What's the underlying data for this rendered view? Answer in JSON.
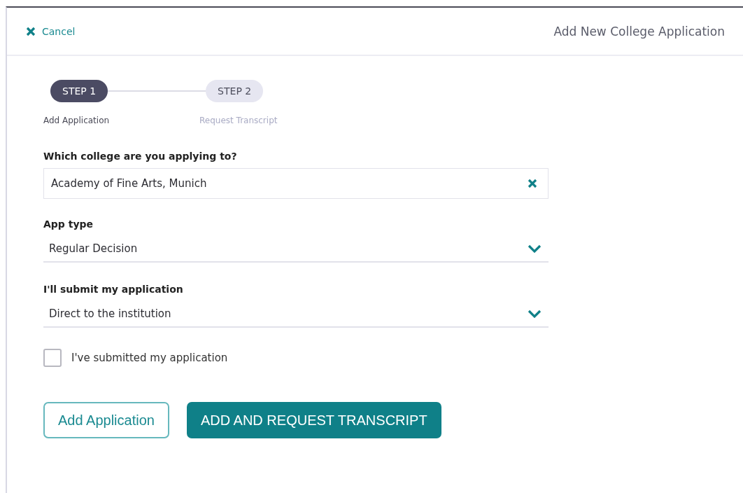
{
  "header": {
    "cancel": "Cancel",
    "title": "Add New College Application"
  },
  "steps": [
    {
      "label": "STEP 1",
      "caption": "Add Application",
      "selected": true
    },
    {
      "label": "STEP 2",
      "caption": "Request Transcript",
      "selected": false
    }
  ],
  "fields": [
    {
      "kind": "text",
      "label": "Which college are you applying to?",
      "value": "Academy of Fine Arts, Munich"
    },
    {
      "kind": "select",
      "label": "App type",
      "value": "Regular Decision"
    },
    {
      "kind": "select",
      "label": "I'll submit my application",
      "value": "Direct to the institution"
    }
  ],
  "checkbox": {
    "label": "I've submitted my application",
    "checked": false
  },
  "buttons": [
    {
      "kind": "outline",
      "label": "Add Application"
    },
    {
      "kind": "primary",
      "label": "ADD AND REQUEST TRANSCRIPT"
    }
  ]
}
